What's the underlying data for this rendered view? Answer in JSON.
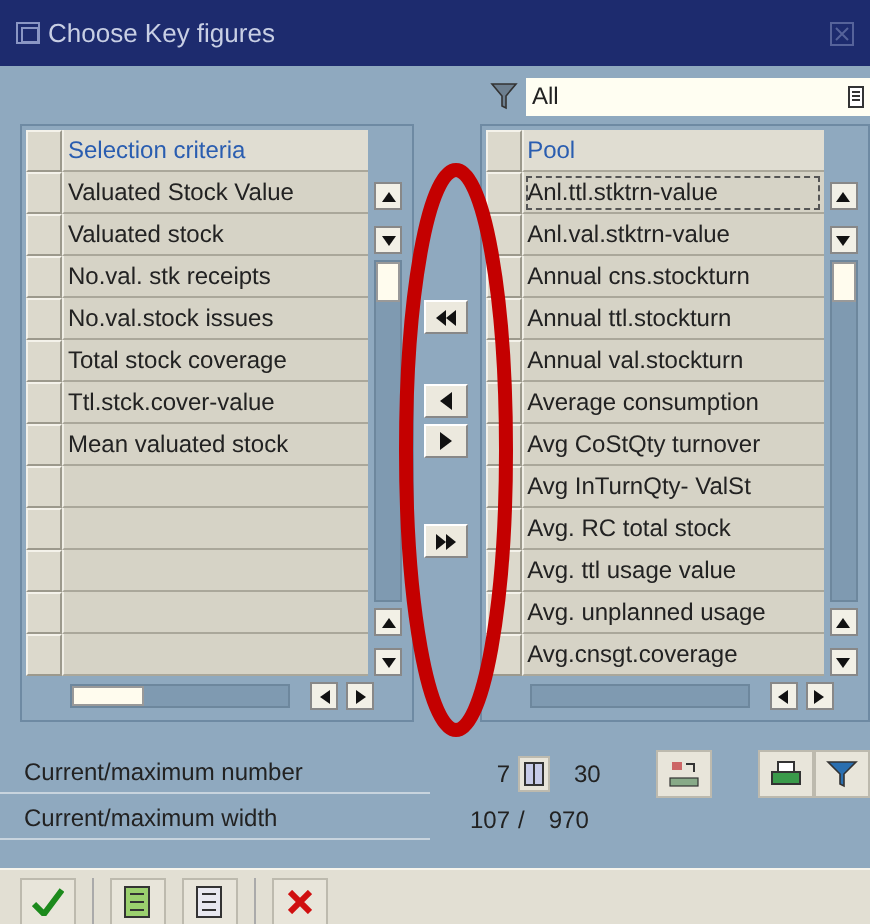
{
  "window": {
    "title": "Choose Key figures"
  },
  "selection_table": {
    "header": "Selection criteria",
    "rows": [
      {
        "text": "Valuated Stock Value",
        "focused": false
      },
      {
        "text": "Valuated stock",
        "focused": false
      },
      {
        "text": "No.val. stk receipts",
        "focused": false
      },
      {
        "text": "No.val.stock issues",
        "focused": false
      },
      {
        "text": "Total stock coverage",
        "focused": false
      },
      {
        "text": "Ttl.stck.cover-value",
        "focused": false
      },
      {
        "text": "Mean valuated stock",
        "focused": false
      }
    ]
  },
  "pool_filter": {
    "value": "All"
  },
  "pool_table": {
    "header": "Pool",
    "rows": [
      {
        "text": "Anl.ttl.stktrn-value",
        "focused": true
      },
      {
        "text": "Anl.val.stktrn-value",
        "focused": false
      },
      {
        "text": "Annual cns.stockturn",
        "focused": false
      },
      {
        "text": "Annual ttl.stockturn",
        "focused": false
      },
      {
        "text": "Annual val.stockturn",
        "focused": false
      },
      {
        "text": "Average consumption",
        "focused": false
      },
      {
        "text": "Avg CoStQty turnover",
        "focused": false
      },
      {
        "text": "Avg InTurnQty- ValSt",
        "focused": false
      },
      {
        "text": "Avg. RC total stock",
        "focused": false
      },
      {
        "text": "Avg. ttl usage value",
        "focused": false
      },
      {
        "text": "Avg. unplanned usage",
        "focused": false
      },
      {
        "text": "Avg.cnsgt.coverage",
        "focused": false
      }
    ]
  },
  "counters": [
    {
      "label": "Current/maximum number",
      "current": "7",
      "maximum": "30"
    },
    {
      "label": "Current/maximum width",
      "current": "107",
      "separator": "/",
      "maximum": "970"
    }
  ],
  "annotation": {
    "kind": "ellipse"
  }
}
